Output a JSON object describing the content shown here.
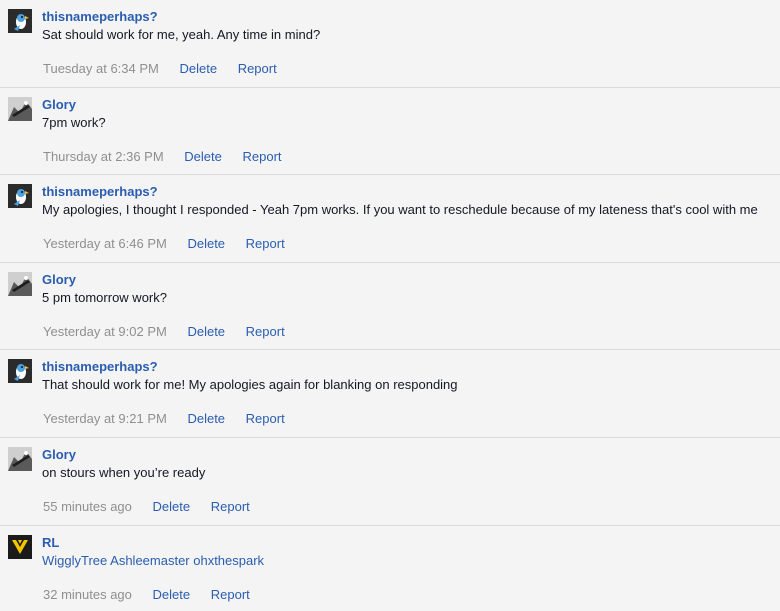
{
  "messages": [
    {
      "author": "thisnameperhaps?",
      "avatar": "penguin-avatar-icon",
      "text": "Sat should work for me, yeah. Any time in mind?",
      "time": "Tuesday at 6:34 PM",
      "delete_label": "Delete",
      "report_label": "Report"
    },
    {
      "author": "Glory",
      "avatar": "ship-avatar-icon",
      "text": "7pm work?",
      "time": "Thursday at 2:36 PM",
      "delete_label": "Delete",
      "report_label": "Report"
    },
    {
      "author": "thisnameperhaps?",
      "avatar": "penguin-avatar-icon",
      "text": "My apologies, I thought I responded - Yeah 7pm works. If you want to reschedule because of my lateness that's cool with me",
      "time": "Yesterday at 6:46 PM",
      "delete_label": "Delete",
      "report_label": "Report"
    },
    {
      "author": "Glory",
      "avatar": "ship-avatar-icon",
      "text": "5 pm tomorrow work?",
      "time": "Yesterday at 9:02 PM",
      "delete_label": "Delete",
      "report_label": "Report"
    },
    {
      "author": "thisnameperhaps?",
      "avatar": "penguin-avatar-icon",
      "text": "That should work for me! My apologies again for blanking on responding",
      "time": "Yesterday at 9:21 PM",
      "delete_label": "Delete",
      "report_label": "Report"
    },
    {
      "author": "Glory",
      "avatar": "ship-avatar-icon",
      "text": "on stours when you’re ready",
      "time": "55 minutes ago",
      "delete_label": "Delete",
      "report_label": "Report"
    },
    {
      "author": "RL",
      "avatar": "team-instinct-avatar-icon",
      "text": "WigglyTree Ashleemaster ohxthespark",
      "time": "32 minutes ago",
      "delete_label": "Delete",
      "report_label": "Report"
    }
  ],
  "colors": {
    "link": "#2a5db0",
    "timestamp": "#8f8f8f",
    "background": "#f4f4f4",
    "divider": "#dcdcdc"
  }
}
